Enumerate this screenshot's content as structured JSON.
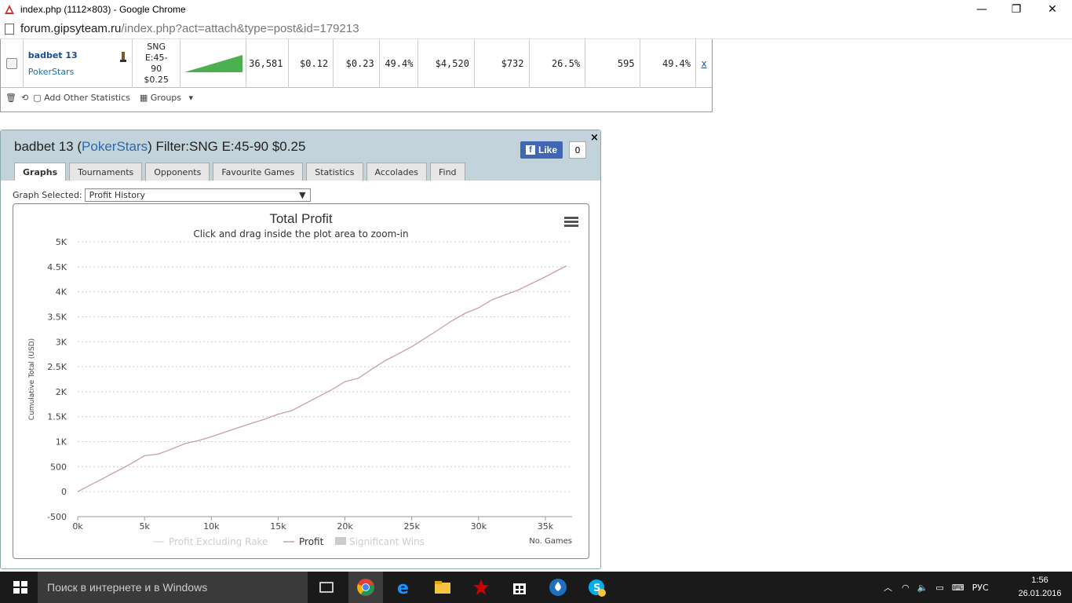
{
  "window": {
    "title": "index.php (1112×803) - Google Chrome",
    "url_domain": "forum.gipsyteam.ru",
    "url_path": "/index.php?act=attach&type=post&id=179213"
  },
  "stats_row": {
    "player": "badbet 13",
    "site": "PokerStars",
    "filter_line1": "SNG",
    "filter_line2": "E:45-",
    "filter_line3": "90",
    "filter_line4": "$0.25",
    "games": "36,581",
    "avg_stake": "$0.12",
    "avg_profit": "$0.23",
    "roi": "49.4%",
    "profit": "$4,520",
    "rake": "$732",
    "itm": "26.5%",
    "rank": "595",
    "pct": "49.4%",
    "remove": "x"
  },
  "stats_toolbar": {
    "add_stats": "Add Other Statistics",
    "groups": "Groups"
  },
  "profile": {
    "name": "badbet 13",
    "open_paren": "(",
    "site": "PokerStars",
    "filter": ") Filter:SNG E:45-90 $0.25",
    "like_label": "Like",
    "like_count": "0",
    "close": "×",
    "tabs": [
      "Graphs",
      "Tournaments",
      "Opponents",
      "Favourite Games",
      "Statistics",
      "Accolades",
      "Find"
    ],
    "graph_selected_label": "Graph Selected:",
    "graph_selected_value": "Profit History"
  },
  "chart_data": {
    "type": "line",
    "title": "Total Profit",
    "subtitle": "Click and drag inside the plot area to zoom-in",
    "ylabel": "Cumulative Total (USD)",
    "xlabel": "No. Games",
    "ylim": [
      -500,
      5000
    ],
    "xlim": [
      0,
      37000
    ],
    "y_ticks": [
      "-500",
      "0",
      "500",
      "1K",
      "1.5K",
      "2K",
      "2.5K",
      "3K",
      "3.5K",
      "4K",
      "4.5K",
      "5K"
    ],
    "x_ticks": [
      "0k",
      "5k",
      "10k",
      "15k",
      "20k",
      "25k",
      "30k",
      "35k"
    ],
    "legend": [
      "Profit Excluding Rake",
      "Profit",
      "Significant Wins"
    ],
    "legend_placement": "bottom",
    "grid": true,
    "series": [
      {
        "name": "Profit",
        "color": "#c9a0a0",
        "x": [
          0,
          2000,
          4000,
          5000,
          6000,
          7000,
          8000,
          9000,
          10000,
          12000,
          14000,
          15000,
          16000,
          18000,
          19000,
          20000,
          21000,
          22000,
          23000,
          25000,
          27000,
          28000,
          29000,
          30000,
          31000,
          33000,
          35000,
          36581
        ],
        "y": [
          0,
          280,
          560,
          720,
          750,
          850,
          960,
          1020,
          1100,
          1280,
          1450,
          1550,
          1620,
          1900,
          2040,
          2200,
          2270,
          2450,
          2620,
          2900,
          3240,
          3420,
          3570,
          3680,
          3840,
          4040,
          4300,
          4520
        ]
      }
    ]
  },
  "taskbar": {
    "search_placeholder": "Поиск в интернете и в Windows",
    "lang": "РУС",
    "time": "1:56",
    "date": "26.01.2016"
  }
}
